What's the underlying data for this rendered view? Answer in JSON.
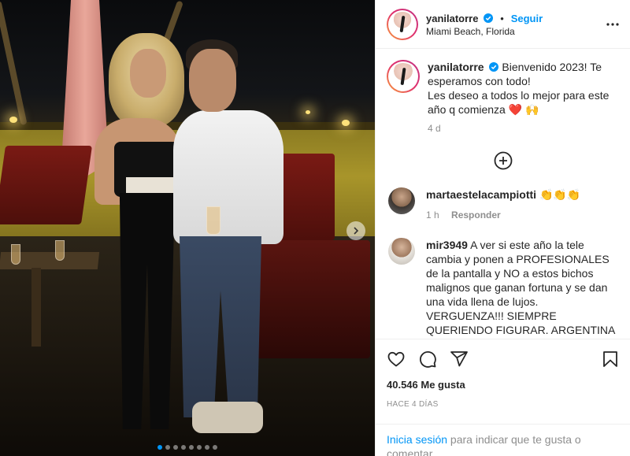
{
  "post": {
    "username": "yanilatorre",
    "follow_label": "Seguir",
    "separator": "•",
    "location": "Miami Beach, Florida",
    "caption": "Bienvenido 2023! Te esperamos con todo!\nLes deseo a todos lo mejor para este año q comienza ❤️ 🙌",
    "caption_line1": "Bienvenido 2023! Te",
    "caption_line2": "esperamos con todo!",
    "caption_line3": "Les deseo a todos lo mejor para este",
    "caption_line4": "año q comienza ❤️ 🙌",
    "caption_time": "4 d"
  },
  "comments": [
    {
      "username": "martaestelacampiotti",
      "text": "👏👏👏",
      "time": "1 h",
      "reply_label": "Responder"
    },
    {
      "username": "mir3949",
      "text": "A ver si este año la tele cambia y ponen a PROFESIONALES de la pantalla y NO a estos bichos malignos que ganan fortuna y se dan una vida llena de lujos. VERGUENZA!!! SIEMPRE QUERIENDO FIGURAR. ARGENTINA"
    }
  ],
  "stats": {
    "likes": "40.546 Me gusta",
    "date": "HACE 4 DÍAS"
  },
  "login_prompt": {
    "link": "Inicia sesión",
    "rest": " para indicar que te gusta o comentar."
  },
  "carousel": {
    "count": 8,
    "active_index": 0
  },
  "colors": {
    "accent": "#0095f6",
    "heart": "#ed4956"
  },
  "icons": [
    "verified-badge-icon",
    "more-options-icon",
    "add-comment-icon",
    "heart-icon",
    "comment-icon",
    "share-icon",
    "bookmark-icon",
    "next-chevron-icon"
  ]
}
